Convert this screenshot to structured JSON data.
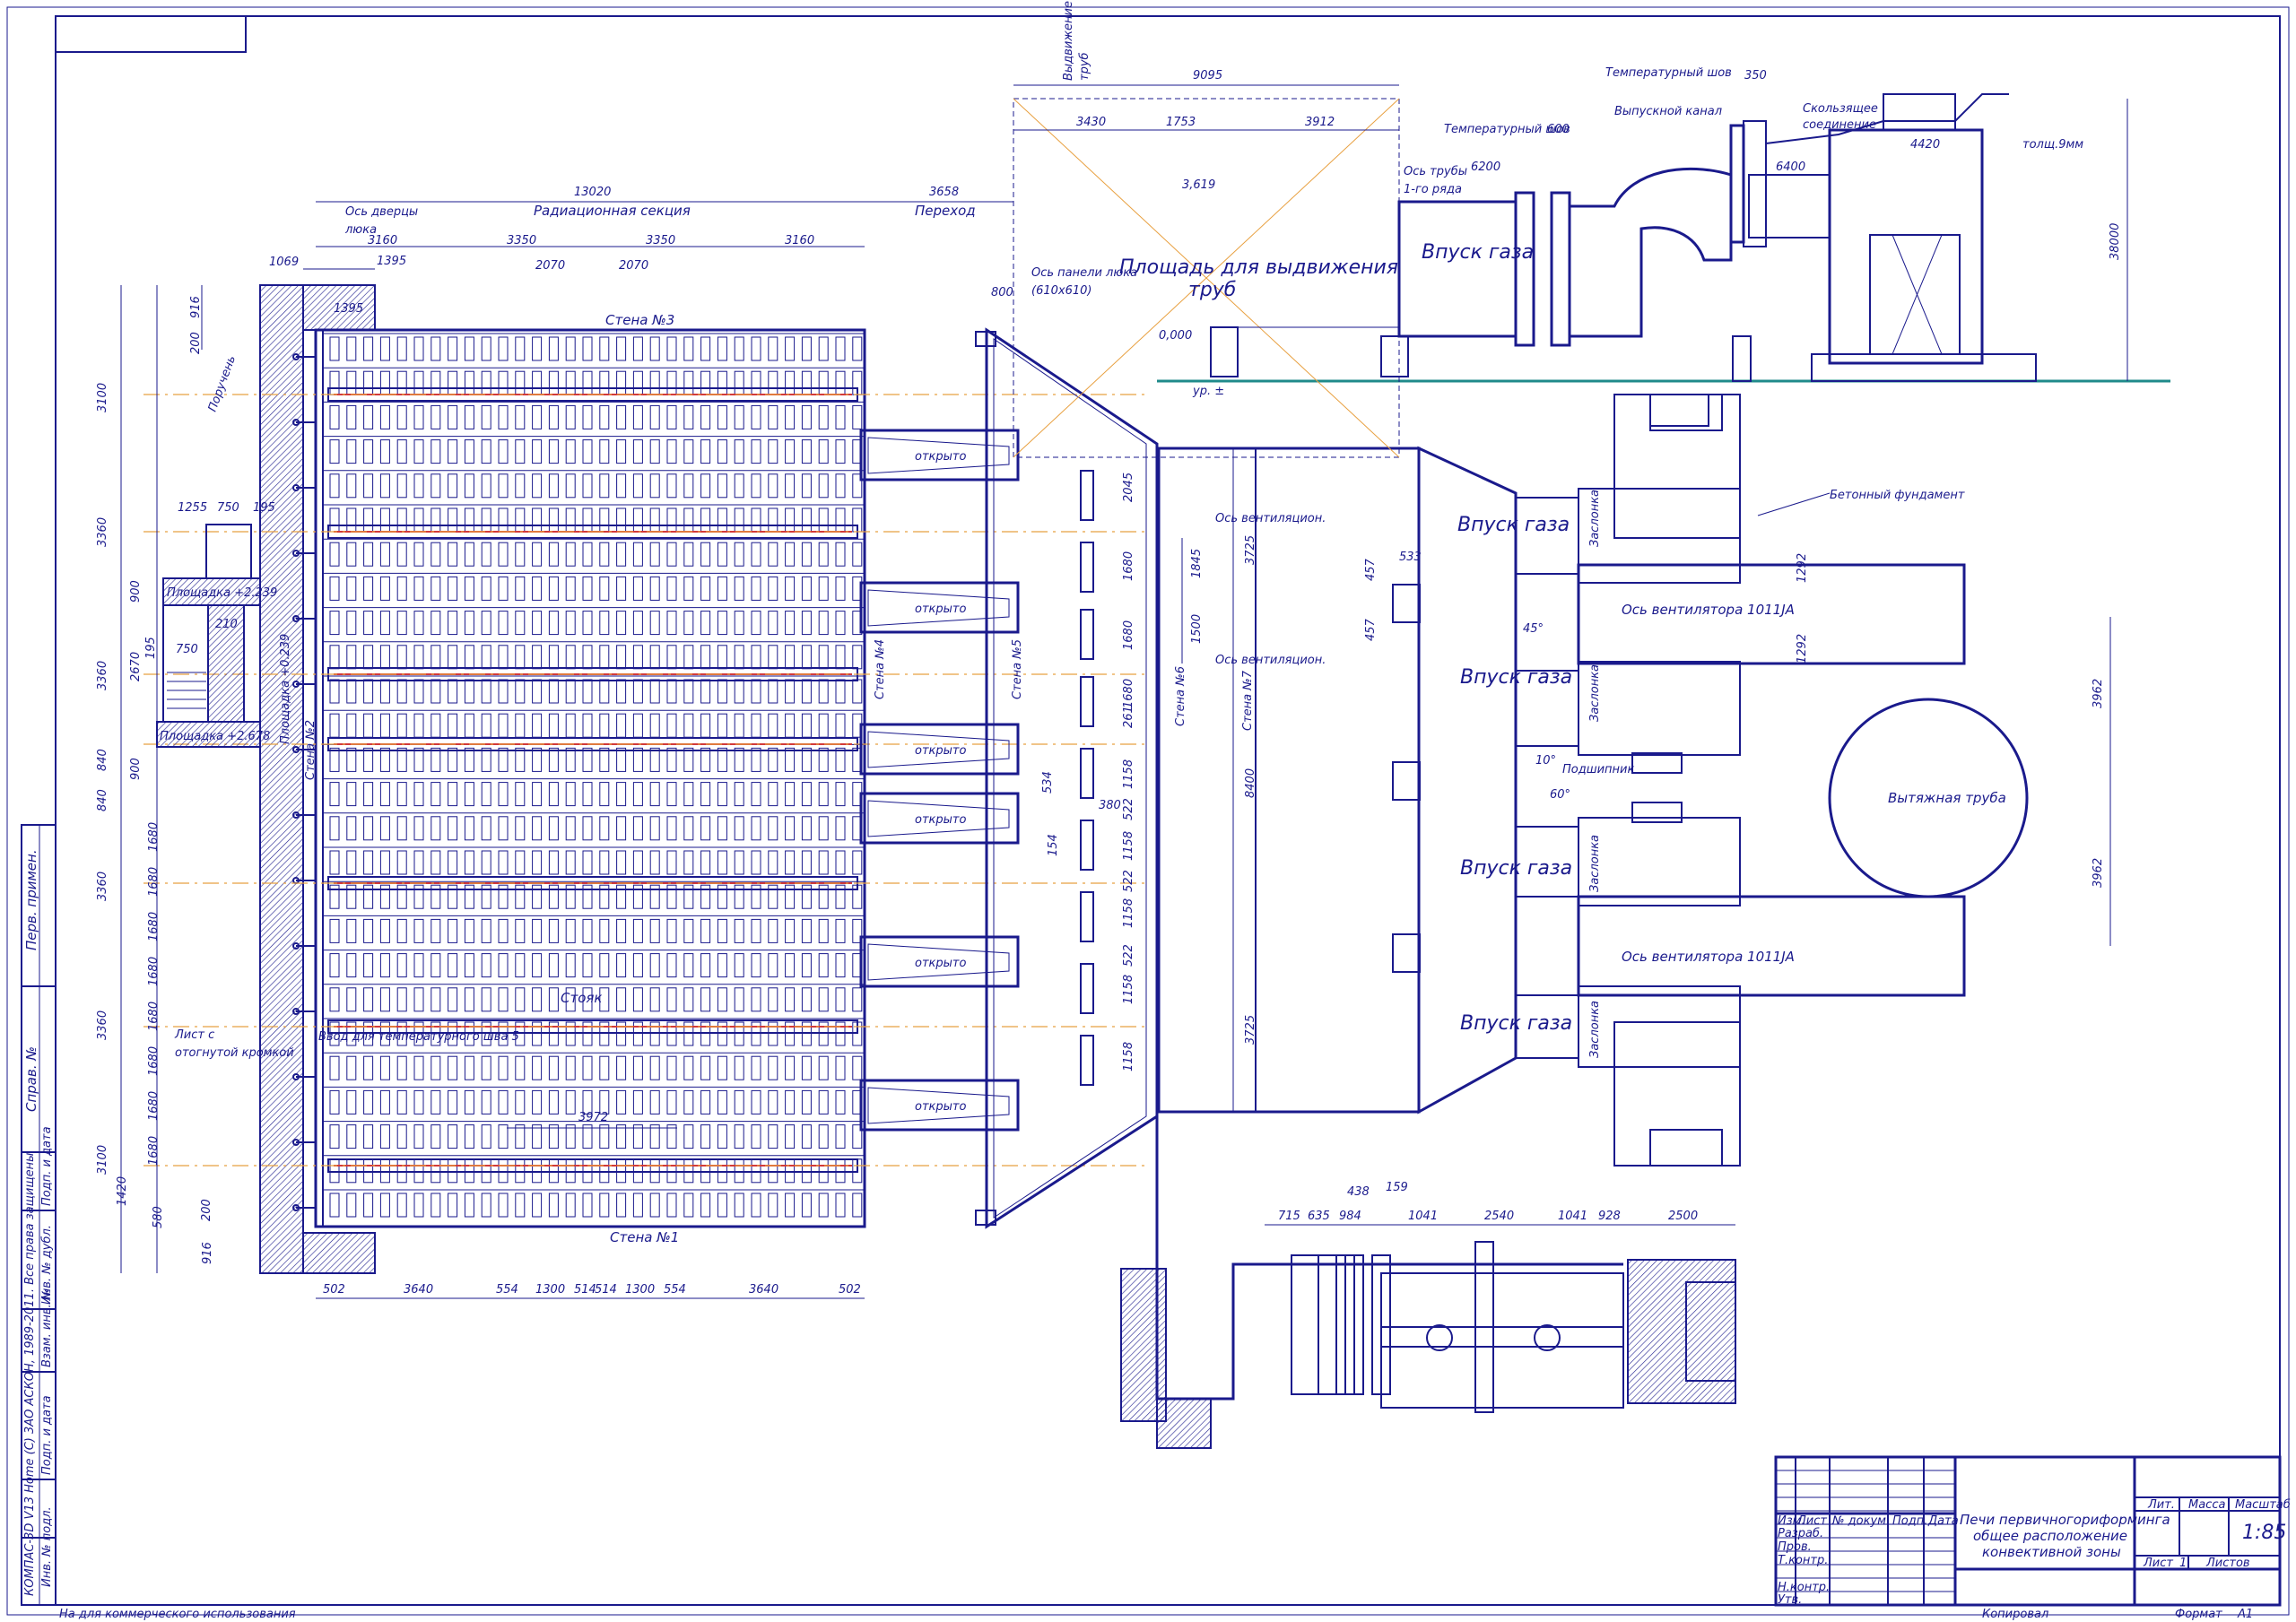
{
  "sheet": {
    "bottom_note": "На для коммерческого использования",
    "kompas_note": "КОМПАС-3D V13 Home (С) 3АО АСКОН, 1989-2011. Все права защищены",
    "copied": "Копировал",
    "format_label": "Формат",
    "format_value": "А1",
    "margin_labels": [
      "Перв. примен.",
      "Справ. №",
      "Подп. и дата",
      "Инв. № дубл.",
      "Взам. инв. №",
      "Подп. и дата",
      "Инв. № подл."
    ]
  },
  "title_block": {
    "title_line1": "Печи первичногориформинга",
    "title_line2": "общее расположение",
    "title_line3": "конвективной зоны",
    "col_izm": "Изм.",
    "col_list": "Лист",
    "col_doc": "№ докум.",
    "col_podp": "Подп.",
    "col_data": "Дата",
    "row_razrab": "Разраб.",
    "row_prov": "Пров.",
    "row_tkontr": "Т.контр.",
    "row_nkontr": "Н.контр.",
    "row_utv": "Утв.",
    "lit": "Лит.",
    "massa": "Масса",
    "masshtab": "Масштаб",
    "scale_value": "1:85",
    "list_label": "Лист",
    "list_value": "1",
    "listov_label": "Листов"
  },
  "furnace": {
    "radiant_section": "Радиационная секция",
    "transition": "Переход",
    "door_axis": "Ось дверцы",
    "door_axis2": "люка",
    "wall3": "Стена №3",
    "wall1": "Стена №1",
    "wall4": "Стена №4",
    "wall5": "Стена №5",
    "wall6": "Стена №6",
    "wall7": "Стена №7",
    "handrail": "Поручень",
    "platform1": "Площадка +2.239",
    "platform2": "Площадка +2.678",
    "platform_v": "Площадка +0.239",
    "open_label": "открыто",
    "riser": "Стояк",
    "sheet_bent": "Лист с",
    "sheet_bent2": "отогнутой кромкой",
    "temp_joint": "Ввод для температурного шва 5",
    "stena2": "Стена №2",
    "vent_axis": "Ось вентиляцион.",
    "panel_axis": "Ось панели люка",
    "panel_axis2": "(610х610)"
  },
  "elevation": {
    "pull_area": "Площадь для выдвижения",
    "pull_area2": "труб",
    "pull_out": "Выдвижение",
    "pull_out2": "труб",
    "pipe_axis": "Ось трубы",
    "pipe_axis2": "1-го ряда",
    "gas_inlet": "Впуск газа",
    "temp_joint": "Температурный шов",
    "exhaust_channel": "Выпускной канал",
    "sliding_joint": "Скользящее",
    "sliding_joint2": "соединение",
    "thickness": "толщ.9мм",
    "zero": "0,000",
    "level": "ур. ±",
    "elev_3619": "3,619"
  },
  "plan": {
    "gas_inlet": "Впуск газа",
    "damper": "Заслонка",
    "fan_axis": "Ось вентилятора 1011JA",
    "bearing": "Подшипник",
    "stack": "Вытяжная труба",
    "concrete_foundation": "Бетонный фундамент",
    "angle_45": "45°",
    "angle_60": "60°",
    "angle_10": "10°"
  },
  "dims": {
    "top_overall": "13020",
    "transition_w": "3658",
    "top_3160a": "3160",
    "top_3350a": "3350",
    "top_3350b": "3350",
    "top_3160b": "3160",
    "top_1395": "1395",
    "top_2070a": "2070",
    "top_2070b": "2070",
    "left_1069": "1069",
    "left_916a": "916",
    "left_200a": "200",
    "left_3100a": "3100",
    "left_3360a": "3360",
    "left_3360b": "3360",
    "left_840a": "840",
    "left_840b": "840",
    "left_3360c": "3360",
    "left_3360d": "3360",
    "left_3100b": "3100",
    "left_1420": "1420",
    "left_580": "580",
    "left_200b": "200",
    "left_916b": "916",
    "left_1680": "1680",
    "stair_1255": "1255",
    "stair_750a": "750",
    "stair_195": "195",
    "stair_900a": "900",
    "stair_210": "210",
    "stair_195b": "195",
    "stair_750b": "750",
    "stair_2670": "2670",
    "stair_900b": "900",
    "bot_502a": "502",
    "bot_3640a": "3640",
    "bot_554a": "554",
    "bot_1300a": "1300",
    "bot_514a": "514",
    "bot_514b": "514",
    "bot_1300b": "1300",
    "bot_554b": "554",
    "bot_3640b": "3640",
    "bot_502b": "502",
    "mid_3972": "3972",
    "d_800": "800",
    "d_2045": "2045",
    "d_1680a": "1680",
    "d_1680b": "1680",
    "d_261": "261",
    "d_1680c": "1680",
    "d_1158a": "1158",
    "d_522a": "522",
    "d_1158b": "1158",
    "d_522b": "522",
    "d_1158c": "1158",
    "d_522c": "522",
    "d_1158d": "1158",
    "d_534": "534",
    "d_380": "380",
    "d_154": "154",
    "d_1845": "1845",
    "d_1500": "1500",
    "d_3725a": "3725",
    "d_8400": "8400",
    "d_3725b": "3725",
    "e_9095": "9095",
    "e_3430": "3430",
    "e_1753": "1753",
    "e_3912": "3912",
    "e_6200": "6200",
    "e_600": "600",
    "e_350": "350",
    "e_6400": "6400",
    "e_4420": "4420",
    "e_38000": "38000",
    "p_457a": "457",
    "p_533": "533",
    "p_457b": "457",
    "p_1292a": "1292",
    "p_1292b": "1292",
    "p_3962a": "3962",
    "p_3962b": "3962",
    "b_715": "715",
    "b_635": "635",
    "b_984": "984",
    "b_438": "438",
    "b_159": "159",
    "b_1041a": "1041",
    "b_2540": "2540",
    "b_1041b": "1041",
    "b_928": "928",
    "b_2500": "2500"
  },
  "colors": {
    "line": "#1a1a8c",
    "axis": "#e8a040",
    "tube": "#d23a3a",
    "ground": "#1f8a8a"
  }
}
